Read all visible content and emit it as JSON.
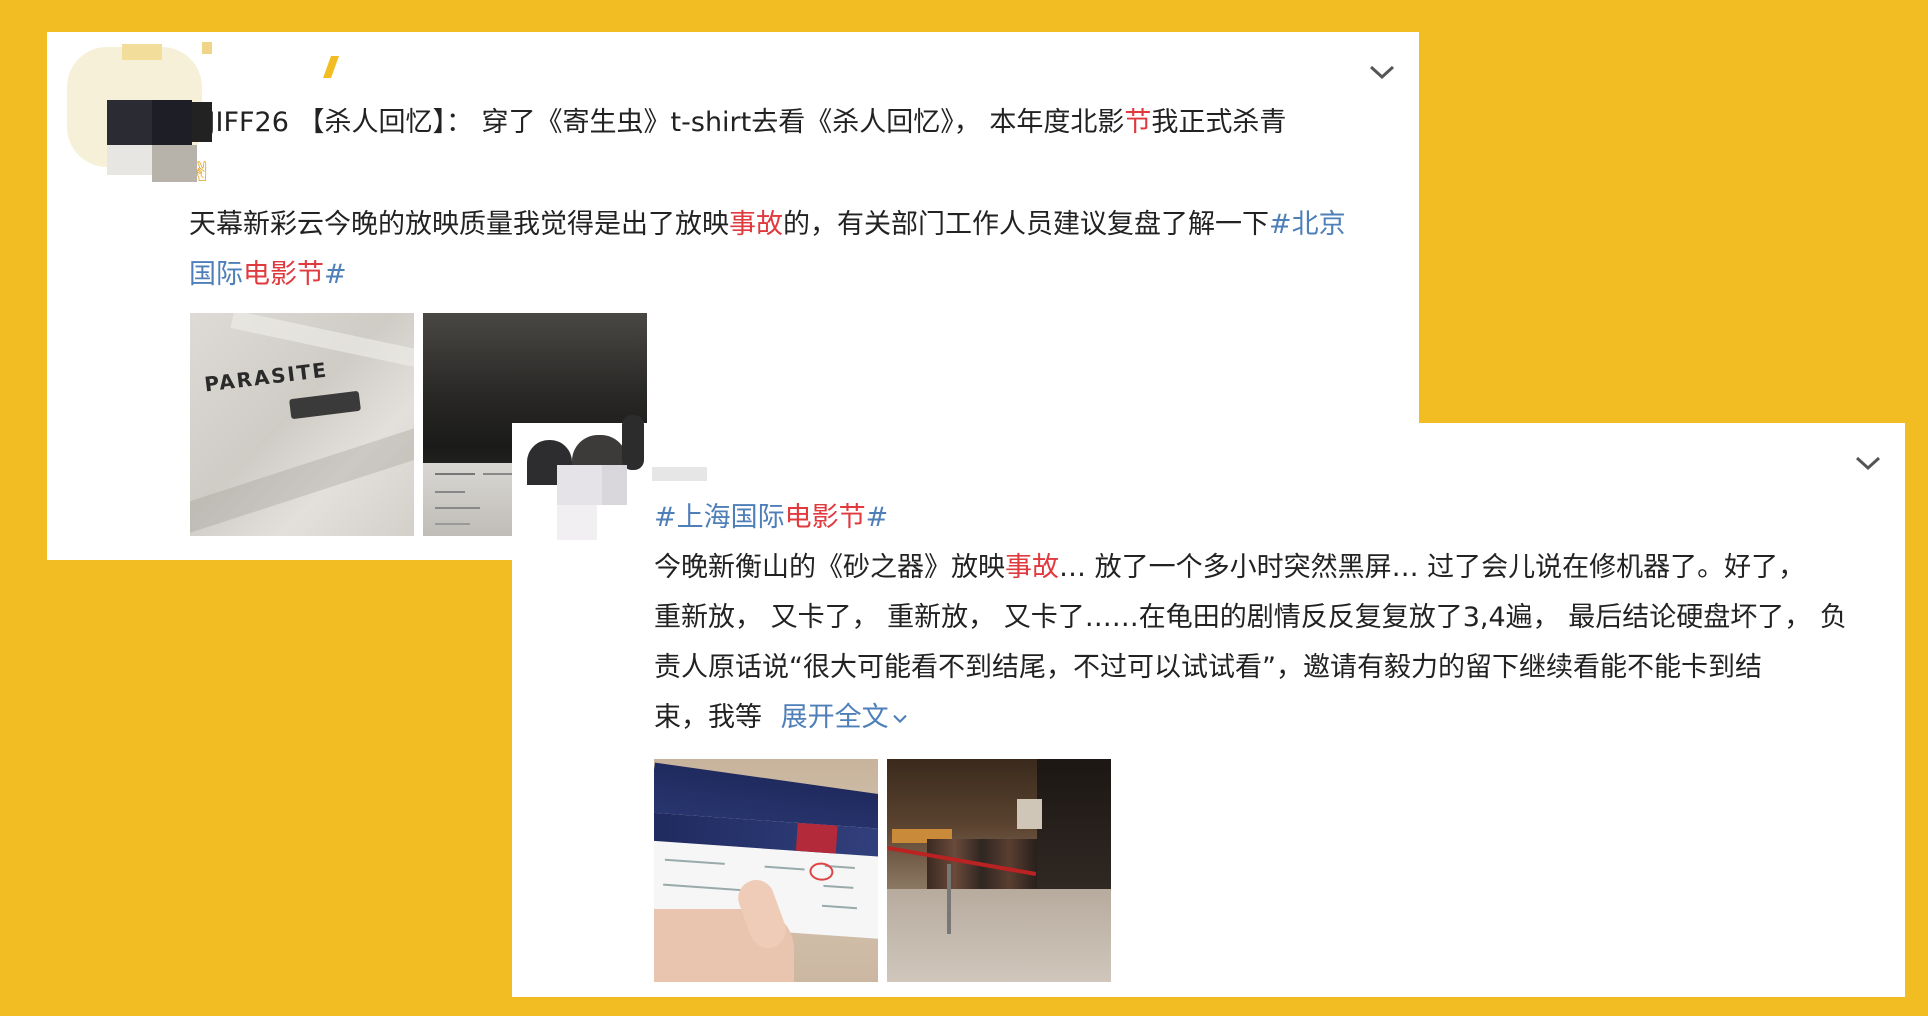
{
  "post1": {
    "username": "BJIFF26",
    "line1_a": "【杀人回忆】： 穿了《寄生虫》t-shirt去看《杀人回忆》， 本年度北影",
    "line1_red": "节",
    "line1_b": "我正式杀青",
    "emoji": "✌",
    "line2_a": "天幕新彩云今晚的放映质量我觉得是出了放映",
    "line2_red": "事故",
    "line2_b": "的，有关部门工作人员建议复盘了解一下",
    "hashtag_a": "#北京",
    "hashtag_b": "国际",
    "hashtag_red": "电影节",
    "hashtag_c": "#",
    "shirt_text": "PARASITE"
  },
  "post2": {
    "hashtag_a": "#上海国际",
    "hashtag_red": "电影节",
    "hashtag_c": "#",
    "line1_a": "今晚新衡山的《砂之器》放映",
    "line1_red": "事故",
    "line1_b": "… 放了一个多小时突然黑屏… 过了会儿说在修机器了。好了，",
    "line2": "重新放， 又卡了， 重新放， 又卡了……在龟田的剧情反反复复放了3,4遍， 最后结论硬盘坏了， 负",
    "line3": "责人原话说“很大可能看不到结尾，不过可以试试看”，邀请有毅力的留下继续看能不能卡到结",
    "line4": "束，我等",
    "expand": "展开全文"
  },
  "colors": {
    "background": "#F2BD23",
    "highlight_red": "#E0393E",
    "link_blue": "#4F7FB8"
  }
}
